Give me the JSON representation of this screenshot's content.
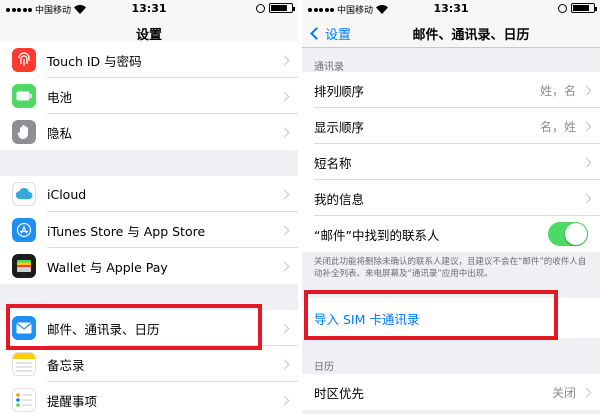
{
  "status_bar": {
    "carrier": "中国移动",
    "time": "13:31"
  },
  "left": {
    "title": "设置",
    "items": [
      {
        "label": "Touch ID 与密码",
        "icon": "fingerprint-icon",
        "color": "#ff3b30"
      },
      {
        "label": "电池",
        "icon": "battery-icon",
        "color": "#4cd964"
      },
      {
        "label": "隐私",
        "icon": "hand-icon",
        "color": "#8e8e93"
      },
      {
        "label": "iCloud",
        "icon": "cloud-icon",
        "color": "#ffffff"
      },
      {
        "label": "iTunes Store 与 App Store",
        "icon": "app-store-icon",
        "color": "#1d8ef5"
      },
      {
        "label": "Wallet 与 Apple Pay",
        "icon": "wallet-icon",
        "color": "#1c1c1e"
      },
      {
        "label": "邮件、通讯录、日历",
        "icon": "mail-icon",
        "color": "#1e90f5"
      },
      {
        "label": "备忘录",
        "icon": "notes-icon",
        "color": "#ffffff"
      },
      {
        "label": "提醒事项",
        "icon": "reminders-icon",
        "color": "#ffffff"
      }
    ]
  },
  "right": {
    "back_label": "设置",
    "title": "邮件、通讯录、日历",
    "contacts_header": "通讯录",
    "rows": [
      {
        "label": "排列顺序",
        "value": "姓，名"
      },
      {
        "label": "显示顺序",
        "value": "名，姓"
      },
      {
        "label": "短名称",
        "value": ""
      },
      {
        "label": "我的信息",
        "value": ""
      },
      {
        "label": "“邮件”中找到的联系人",
        "value": ""
      }
    ],
    "toggle_on": true,
    "footer": "关闭此功能将删除未确认的联系人建议，且建议不会在“邮件”的收件人自动补全列表、来电屏幕及“通讯录”应用中出现。",
    "import_sim": "导入 SIM 卡通讯录",
    "calendar_header": "日历",
    "time_zone_label": "时区优先",
    "time_zone_value": "关闭"
  },
  "colors": {
    "accent": "#007aff",
    "highlight": "#e51925",
    "toggle": "#4cd964"
  }
}
